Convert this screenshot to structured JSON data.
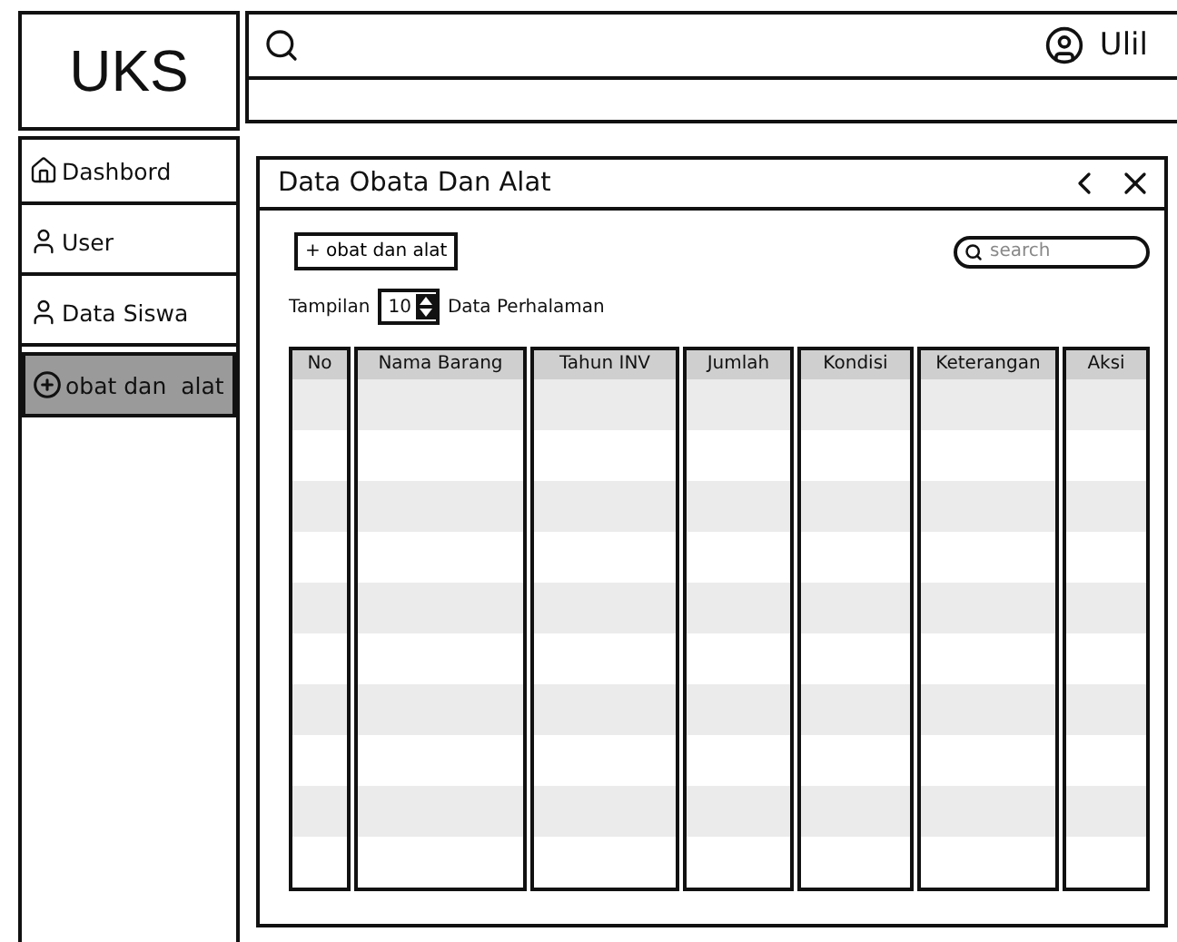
{
  "logo": "UKS",
  "topbar": {
    "user": "Ulil"
  },
  "sidebar": {
    "items": [
      {
        "label": "Dashbord",
        "selected": false
      },
      {
        "label": "User",
        "selected": false
      },
      {
        "label": "Data Siswa",
        "selected": false
      },
      {
        "label": "obat dan  alat",
        "selected": true
      }
    ]
  },
  "panel": {
    "title": "Data Obata Dan Alat",
    "add_button": "+ obat dan alat",
    "search": {
      "placeholder": "search"
    },
    "page_size": {
      "label": "Tampilan",
      "value": "10",
      "suffix": "Data Perhalaman"
    },
    "table": {
      "columns": [
        "No",
        "Nama Barang",
        "Tahun INV",
        "Jumlah",
        "Kondisi",
        "Keterangan",
        "Aksi"
      ]
    }
  }
}
